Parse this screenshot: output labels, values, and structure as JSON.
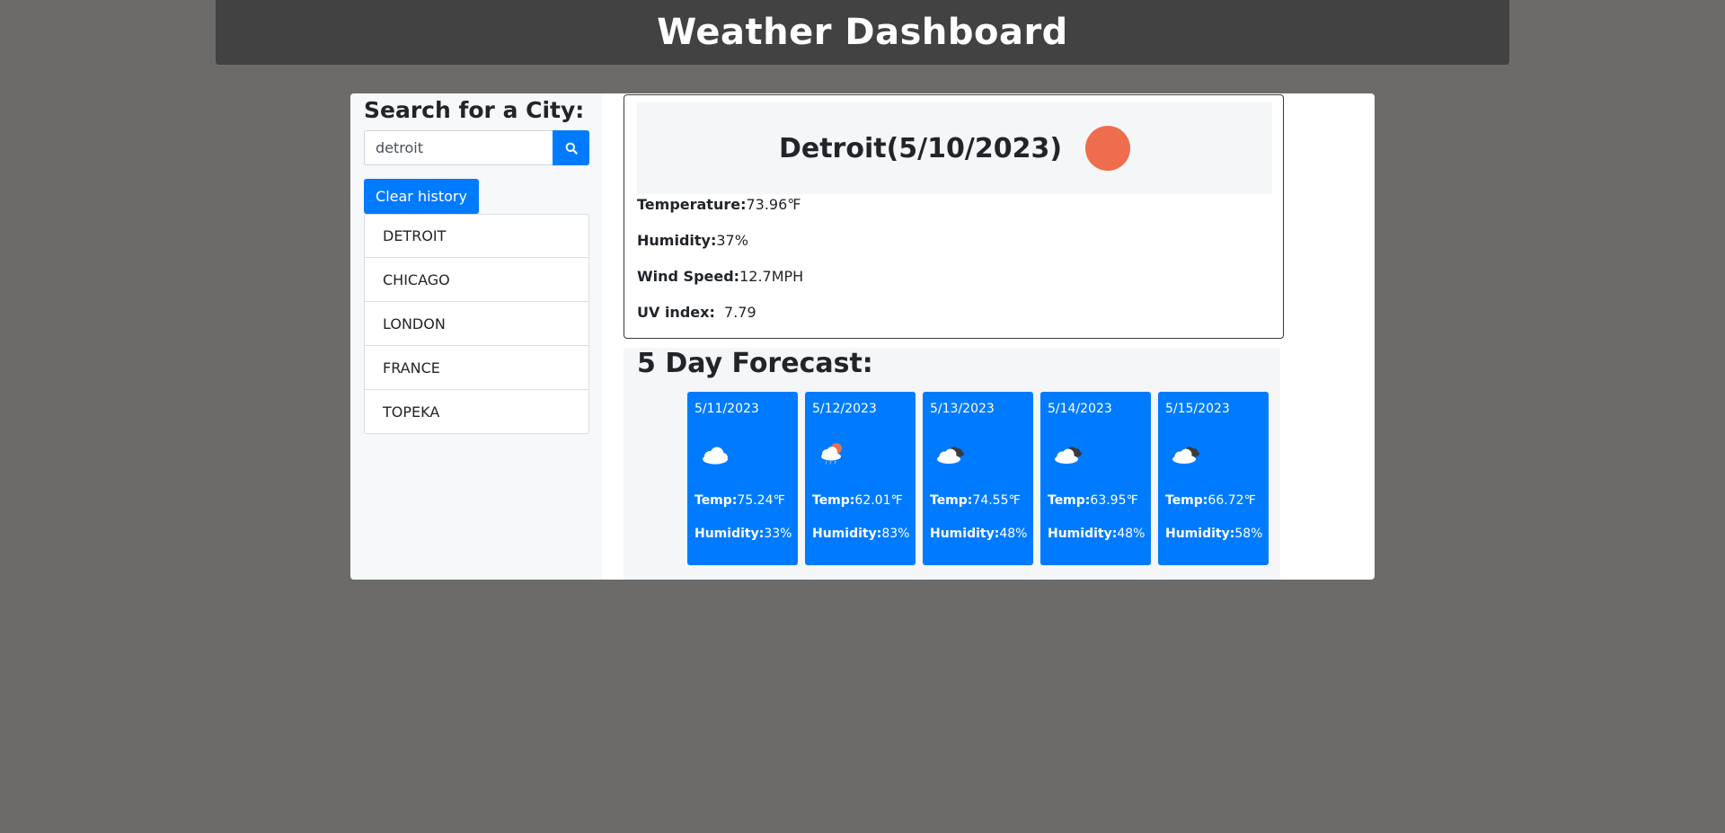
{
  "header": {
    "title": "Weather Dashboard"
  },
  "sidebar": {
    "heading": "Search for a City:",
    "search": {
      "value": "detroit",
      "button_icon": "search-icon"
    },
    "clear_label": "Clear history",
    "history": [
      "DETROIT",
      "CHICAGO",
      "LONDON",
      "FRANCE",
      "TOPEKA"
    ]
  },
  "current": {
    "title": "Detroit(5/10/2023)",
    "icon": "sun-icon",
    "icon_color": "#ee6d4d",
    "temperature_label": "Temperature:",
    "temperature_value": "73.96℉",
    "humidity_label": "Humidity:",
    "humidity_value": "37%",
    "wind_label": "Wind Speed:",
    "wind_value": "12.7MPH",
    "uv_label": "UV index:",
    "uv_value": "7.79"
  },
  "forecast": {
    "heading": "5 Day Forecast:",
    "temp_label": "Temp:",
    "humidity_label": "Humidity:",
    "days": [
      {
        "date": "5/11/2023",
        "icon": "cloud-icon",
        "temp": "75.24℉",
        "humidity": "33%"
      },
      {
        "date": "5/12/2023",
        "icon": "rain-cloud-sun-icon",
        "temp": "62.01℉",
        "humidity": "83%"
      },
      {
        "date": "5/13/2023",
        "icon": "broken-clouds-icon",
        "temp": "74.55℉",
        "humidity": "48%"
      },
      {
        "date": "5/14/2023",
        "icon": "broken-clouds-icon",
        "temp": "63.95℉",
        "humidity": "48%"
      },
      {
        "date": "5/15/2023",
        "icon": "broken-clouds-icon",
        "temp": "66.72℉",
        "humidity": "58%"
      }
    ]
  },
  "colors": {
    "page_background": "#6d6b69",
    "header_background": "#424242",
    "primary": "#007bff",
    "panel_background": "#f7f8f9"
  }
}
